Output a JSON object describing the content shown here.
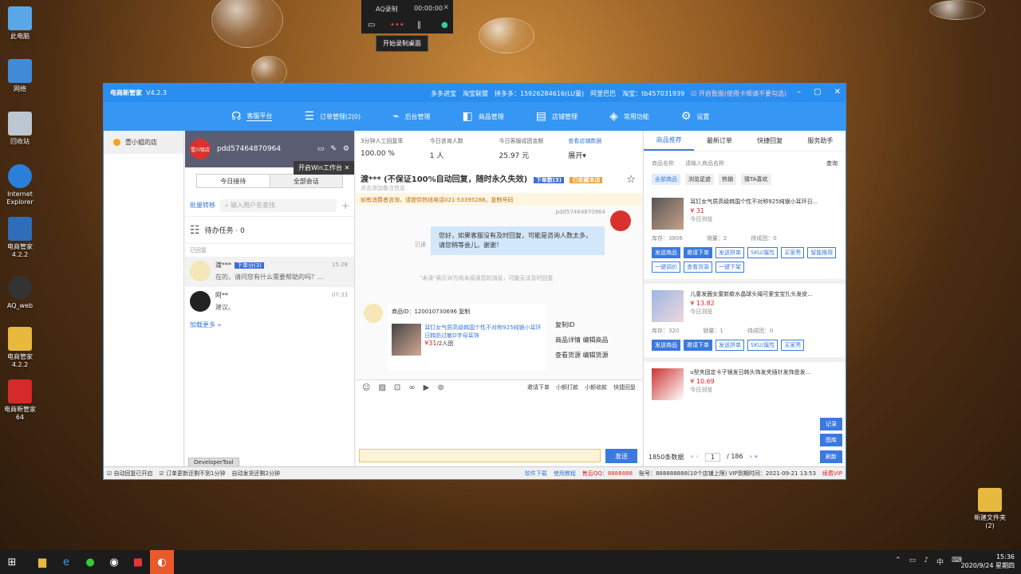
{
  "desktop": {
    "icons": [
      "此电脑",
      "网络",
      "回收站",
      "Internet Explorer",
      "电商管家 4.2.2",
      "AQ_web",
      "电商管家 4.2.2",
      "电商新管家 64"
    ],
    "folder": "新建文件夹 (2)"
  },
  "recorder": {
    "title": "AQ录制",
    "time": "00:00:00",
    "tooltip": "开始录制桌面"
  },
  "window": {
    "title": "电商新管家",
    "version": "V4.2.3",
    "platforms": [
      "多多进宝",
      "淘宝联盟",
      "拼多多：15926284616(LU童)",
      "阿里巴巴",
      "淘宝：tb457031939"
    ],
    "autoreply": "开启暂振(使用卡顿请不要勾选)"
  },
  "nav": [
    "客服平台",
    "订单管理(2|0)",
    "后台管理",
    "商品管理",
    "店铺管理",
    "常用功能",
    "设置"
  ],
  "shop": "壹小姐的店",
  "account": {
    "avatar": "雪川铭店",
    "name": "pdd57464870964",
    "win_tip": "开启Win工作台"
  },
  "conv_tabs": [
    "今日接待",
    "全部会话"
  ],
  "batch": "批量转移",
  "search_ph": "输入用户名查找",
  "todo": "待办任务 · 0",
  "group": "已回复",
  "conversations": [
    {
      "name": "渡***",
      "tag": "下单分(3)",
      "time": "15:28",
      "msg": "在的，请问您有什么需要帮助的吗？..."
    },
    {
      "name": "阿**",
      "tag": "",
      "time": "07:33",
      "msg": "建议。"
    }
  ],
  "more": "加载更多 »",
  "devtool": "DeveloperTool",
  "stats": [
    {
      "label": "3分钟人工回复率",
      "value": "100.00 %"
    },
    {
      "label": "今日咨询人数",
      "value": "1 人"
    },
    {
      "label": "今日客服成团金额",
      "value": "25.97 元"
    },
    {
      "label": "查看店铺数据",
      "value": "展开▾"
    }
  ],
  "chat": {
    "header": "渡*** (不保证100%自动回复，随时永久失效)",
    "sub": "点击添加备注信息",
    "badge1": "下单数(3)",
    "badge2": "已收藏本店",
    "notice": "如有消费者咨询，请提供热线电话021-53395288。复制号码",
    "sender": "pdd57464870964",
    "reply": "您好，如果客服没有及时回复，可能是咨询人数太多，请您稍等会儿，谢谢！",
    "read": "已读",
    "system": "\"未读\"表示对方尚未阅读您的消息，可能无法及时回复",
    "product_id": "商品ID：120010730696 复制",
    "product_title": "耳钉女气质高级韩国个性不对称925纯银小耳环日韩防过敏D字母耳饰",
    "product_price": "¥31",
    "product_unit": "/2人团",
    "menu": [
      "复制ID",
      "商品详情 编辑商品",
      "查看货源 编辑货源"
    ],
    "tools": [
      "邀请下单",
      "小额打款",
      "小额收款",
      "快捷回复"
    ],
    "send": "发送"
  },
  "right": {
    "tabs": [
      "商品推荐",
      "最新订单",
      "快捷回复",
      "服务助手"
    ],
    "filter": "商品名称",
    "search_ph": "请输入商品名称",
    "query": "查询",
    "chips": [
      "全部商品",
      "浏览足迹",
      "热销",
      "猜TA喜欢"
    ],
    "products": [
      {
        "title": "耳钉女气质高级韩国个性不对称925纯银小耳环日...",
        "price": "¥ 31",
        "tag": "今日浏览",
        "stock": "库存：3806",
        "sold": "销量：2",
        "pending": "待成团：0",
        "btns": [
          "发送商品",
          "邀请下单",
          "发送拼单",
          "SKU/属性",
          "买家秀",
          "智能推荐",
          "一键调价",
          "查看货源",
          "一键下架"
        ]
      },
      {
        "title": "儿童发圈女童新款水晶球头绳可爱宝宝扎头发皮...",
        "price": "¥ 13.82",
        "tag": "今日浏览",
        "stock": "库存：320",
        "sold": "销量：1",
        "pending": "待成团：0",
        "btns": [
          "发送商品",
          "邀请下单",
          "发送拼单",
          "SKU/属性",
          "买家秀"
        ]
      },
      {
        "title": "u型夹固定卡子镜发日韩头饰发夹插针发饰盘发...",
        "price": "¥ 10.69",
        "tag": "今日浏览"
      }
    ],
    "side": [
      "记录",
      "图库",
      "刷新"
    ],
    "total": "1850条数据",
    "page": "1",
    "pages": "/ 186"
  },
  "status": {
    "items": [
      "自动回复已开启",
      "订单更新还剩不到1分钟",
      "自动发货还剩2分钟"
    ],
    "links": [
      "软件下载",
      "使用教程"
    ],
    "qq": "售后QQ：8888888",
    "acct": "账号：888888888(10个店铺上限) VIP到期时间：2021-09-21 13:53",
    "renew": "续费VIP"
  },
  "clock": {
    "time": "15:36",
    "date": "2020/9/24 星期四"
  }
}
